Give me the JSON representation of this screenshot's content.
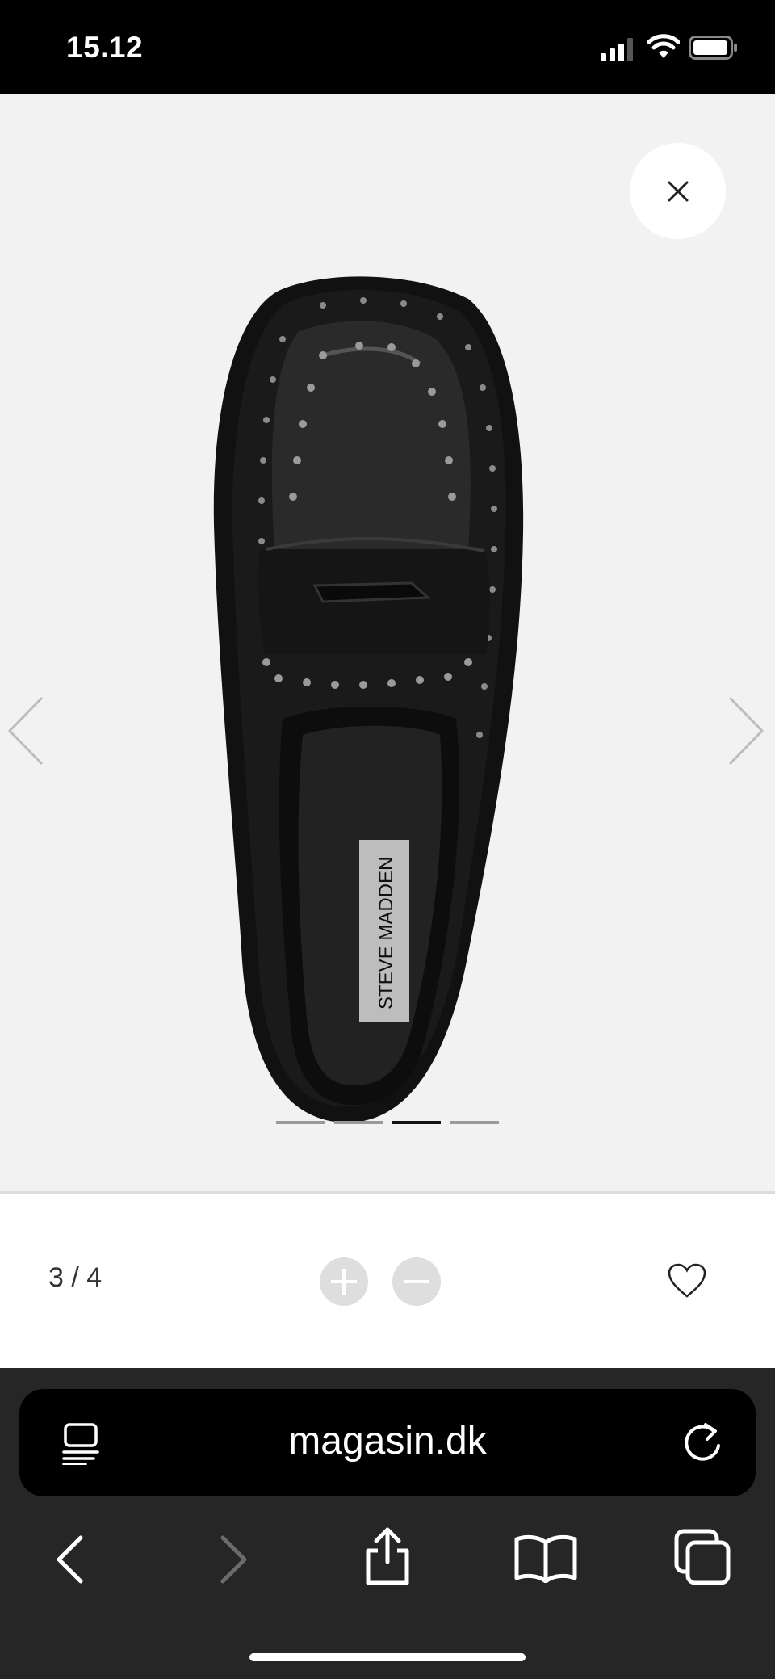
{
  "status_bar": {
    "time": "15.12"
  },
  "gallery": {
    "product_label": "STEVE MADDEN",
    "slide_count": 4,
    "active_slide": 3
  },
  "toolbar": {
    "counter": "3 / 4"
  },
  "browser": {
    "url": "magasin.dk"
  },
  "colors": {
    "status_bg": "#000000",
    "gallery_bg": "#f2f2f2",
    "chrome_bg": "#262626"
  }
}
